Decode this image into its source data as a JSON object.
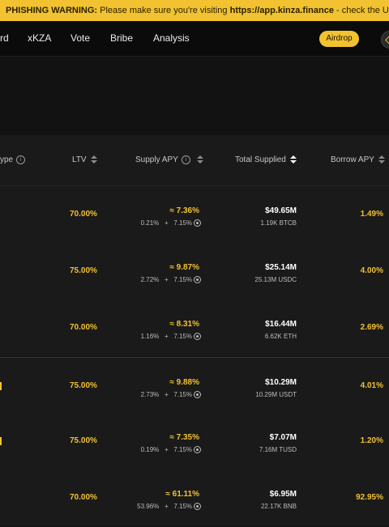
{
  "warning": {
    "title": "PHISHING WARNING:",
    "text_before": "Please make sure you're visiting",
    "url": "https://app.kinza.finance",
    "text_after": "- check the URL carefully."
  },
  "nav": {
    "items": [
      "rd",
      "xKZA",
      "Vote",
      "Bribe",
      "Analysis"
    ],
    "airdrop_label": "Airdrop",
    "accent": "#f2c230"
  },
  "table": {
    "headers": {
      "type": "ype",
      "ltv": "LTV",
      "supply_apy": "Supply APY",
      "total_supplied": "Total Supplied",
      "borrow_apy": "Borrow APY"
    },
    "rows": [
      {
        "ltv": "70.00%",
        "apy": "≈ 7.36%",
        "base": "0.21%",
        "plus": "+",
        "reward": "7.15%",
        "supplied": "$49.65M",
        "amount": "1.19K BTCB",
        "borrow": "1.49%"
      },
      {
        "ltv": "75.00%",
        "apy": "≈ 9.87%",
        "base": "2.72%",
        "plus": "+",
        "reward": "7.15%",
        "supplied": "$25.14M",
        "amount": "25.13M USDC",
        "borrow": "4.00%"
      },
      {
        "ltv": "70.00%",
        "apy": "≈ 8.31%",
        "base": "1.16%",
        "plus": "+",
        "reward": "7.15%",
        "supplied": "$16.44M",
        "amount": "6.62K ETH",
        "borrow": "2.69%"
      },
      {
        "ltv": "75.00%",
        "apy": "≈ 9.88%",
        "base": "2.73%",
        "plus": "+",
        "reward": "7.15%",
        "supplied": "$10.29M",
        "amount": "10.29M USDT",
        "borrow": "4.01%"
      },
      {
        "ltv": "75.00%",
        "apy": "≈ 7.35%",
        "base": "0.19%",
        "plus": "+",
        "reward": "7.15%",
        "supplied": "$7.07M",
        "amount": "7.16M TUSD",
        "borrow": "1.20%"
      },
      {
        "ltv": "70.00%",
        "apy": "≈ 61.11%",
        "base": "53.96%",
        "plus": "+",
        "reward": "7.15%",
        "supplied": "$6.95M",
        "amount": "22.17K BNB",
        "borrow": "92.95%"
      }
    ]
  }
}
